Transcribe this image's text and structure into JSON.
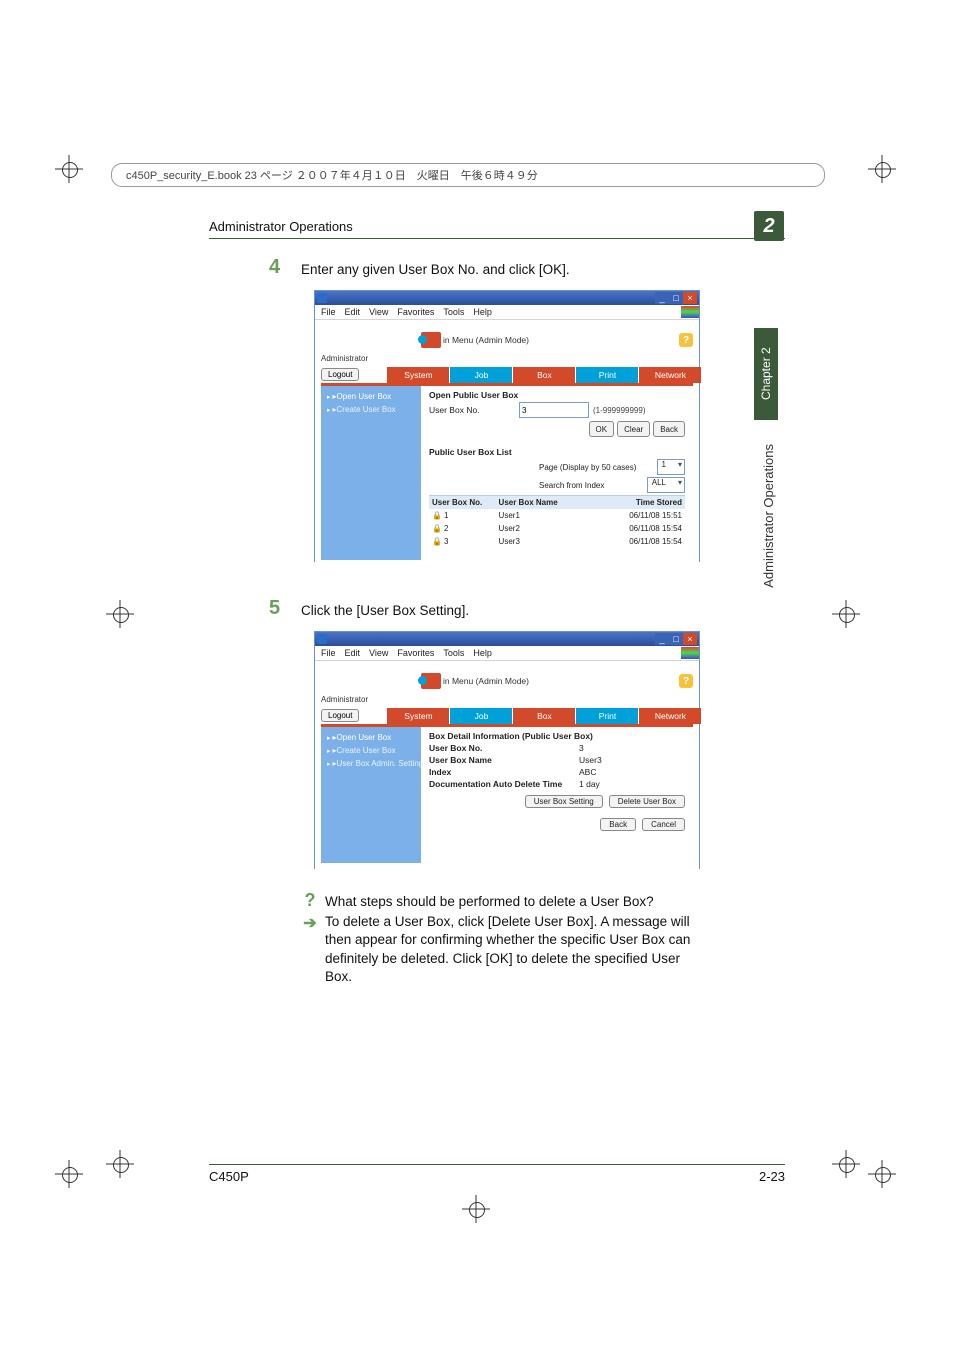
{
  "print_header": "c450P_security_E.book  23 ページ  ２００７年４月１０日　火曜日　午後６時４９分",
  "header": {
    "title": "Administrator Operations",
    "chapter_num": "2"
  },
  "side": {
    "chapter": "Chapter 2",
    "label": "Administrator Operations"
  },
  "step4": {
    "num": "4",
    "text": "Enter any given User Box No. and click [OK]."
  },
  "step5": {
    "num": "5",
    "text": "Click the [User Box Setting]."
  },
  "ie": {
    "menus": {
      "file": "File",
      "edit": "Edit",
      "view": "View",
      "favorites": "Favorites",
      "tools": "Tools",
      "help": "Help"
    },
    "admin_mode": "in Menu (Admin Mode)",
    "administrator": "Administrator",
    "logout": "Logout",
    "tabs": {
      "system": "System",
      "job": "Job",
      "box": "Box",
      "print": "Print",
      "network": "Network"
    }
  },
  "shot1": {
    "leftnav": {
      "open": "▸Open User Box",
      "create": "▸Create User Box"
    },
    "section_title": "Open Public User Box",
    "userbox_label": "User Box No.",
    "userbox_value": "3",
    "range": "(1-999999999)",
    "buttons": {
      "ok": "OK",
      "clear": "Clear",
      "back": "Back"
    },
    "list_title": "Public User Box List",
    "page_label": "Page (Display by 50 cases)",
    "page_value": "1",
    "index_label": "Search from Index",
    "index_value": "ALL",
    "columns": {
      "no": "User Box No.",
      "name": "User Box Name",
      "time": "Time Stored"
    },
    "rows": [
      {
        "no": "1",
        "name": "User1",
        "time": "06/11/08 15:51"
      },
      {
        "no": "2",
        "name": "User2",
        "time": "06/11/08 15:54"
      },
      {
        "no": "3",
        "name": "User3",
        "time": "06/11/08 15:54"
      }
    ]
  },
  "shot2": {
    "leftnav": {
      "open": "▸Open User Box",
      "create": "▸Create User Box",
      "settings": "▸User Box Admin. Settings"
    },
    "detail_title": "Box Detail Information (Public User Box)",
    "rows": {
      "no_l": "User Box No.",
      "no_v": "3",
      "name_l": "User Box Name",
      "name_v": "User3",
      "index_l": "Index",
      "index_v": "ABC",
      "del_l": "Documentation Auto Delete Time",
      "del_v": "1 day"
    },
    "buttons": {
      "ubs": "User Box Setting",
      "del": "Delete User Box",
      "back": "Back",
      "cancel": "Cancel"
    }
  },
  "qa": {
    "q": "What steps should be performed to delete a User Box?",
    "a": "To delete a User Box, click [Delete User Box]. A message will then appear for confirming whether the specific User Box can definitely be deleted. Click [OK] to delete the specified User Box."
  },
  "footer": {
    "left": "C450P",
    "right": "2-23"
  }
}
